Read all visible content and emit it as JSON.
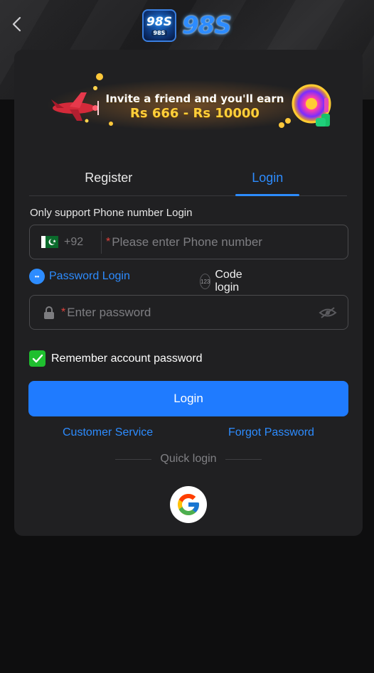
{
  "header": {
    "back_icon": "chevron-left-icon",
    "logo_badge_text": "98S",
    "logo_badge_sub": "98S",
    "logo_text": "98S"
  },
  "banner": {
    "line1": "Invite a friend and you'll earn",
    "line2": "Rs 666 - Rs 10000"
  },
  "tabs": [
    {
      "label": "Register",
      "active": false
    },
    {
      "label": "Login",
      "active": true
    }
  ],
  "form": {
    "support_label": "Only support Phone number Login",
    "country_code": "+92",
    "phone_placeholder": "Please enter Phone number",
    "required_mark": "*",
    "modes": {
      "password_label": "Password Login",
      "code_label": "Code login",
      "code_icon_text": "123"
    },
    "password_placeholder": "Enter password",
    "remember_label": "Remember account password",
    "remember_checked": true,
    "login_button": "Login"
  },
  "links": {
    "customer_service": "Customer Service",
    "forgot_password": "Forgot Password"
  },
  "quick_login": {
    "label": "Quick login",
    "provider_icon": "google-icon"
  },
  "colors": {
    "accent": "#1f7bff",
    "link": "#2d8cff",
    "checkbox": "#1fbf2f",
    "required": "#e0423b",
    "card": "#202022",
    "background": "#0e0e0f"
  }
}
